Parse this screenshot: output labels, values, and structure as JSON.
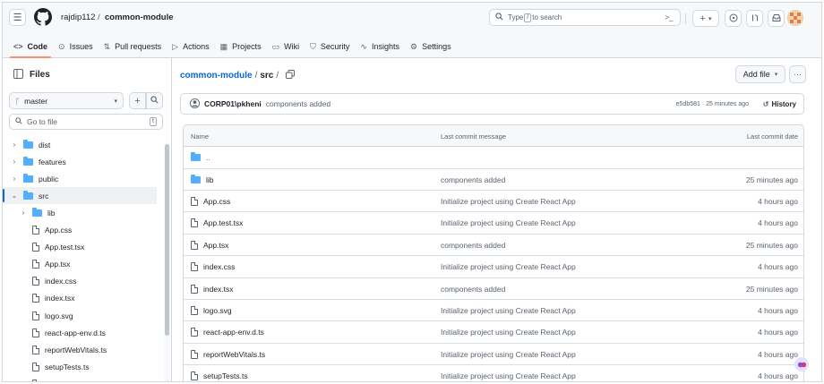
{
  "header": {
    "owner": "rajdip112",
    "separator": "/",
    "repo": "common-module",
    "search_placeholder": "Type",
    "search_key": "/",
    "search_suffix": "to search",
    "terminal_icon": ">_",
    "plus_label": "+",
    "plus_caret": "▾"
  },
  "tabs": [
    {
      "icon": "<>",
      "label": "Code"
    },
    {
      "icon": "⊙",
      "label": "Issues"
    },
    {
      "icon": "⇅",
      "label": "Pull requests"
    },
    {
      "icon": "▷",
      "label": "Actions"
    },
    {
      "icon": "▦",
      "label": "Projects"
    },
    {
      "icon": "▭",
      "label": "Wiki"
    },
    {
      "icon": "⛉",
      "label": "Security"
    },
    {
      "icon": "∿",
      "label": "Insights"
    },
    {
      "icon": "⚙",
      "label": "Settings"
    }
  ],
  "sidebar": {
    "title": "Files",
    "branch": "master",
    "goto_placeholder": "Go to file",
    "goto_key": "t",
    "tree": [
      {
        "type": "folder",
        "name": "dist",
        "chev": "›"
      },
      {
        "type": "folder",
        "name": "features",
        "chev": "›"
      },
      {
        "type": "folder",
        "name": "public",
        "chev": "›"
      },
      {
        "type": "folder",
        "name": "src",
        "chev": "⌄"
      },
      {
        "type": "folder",
        "name": "lib",
        "chev": "›"
      },
      {
        "type": "file",
        "name": "App.css"
      },
      {
        "type": "file",
        "name": "App.test.tsx"
      },
      {
        "type": "file",
        "name": "App.tsx"
      },
      {
        "type": "file",
        "name": "index.css"
      },
      {
        "type": "file",
        "name": "index.tsx"
      },
      {
        "type": "file",
        "name": "logo.svg"
      },
      {
        "type": "file",
        "name": "react-app-env.d.ts"
      },
      {
        "type": "file",
        "name": "reportWebVitals.ts"
      },
      {
        "type": "file",
        "name": "setupTests.ts"
      },
      {
        "type": "file",
        "name": "vite-env.d.ts"
      }
    ]
  },
  "main": {
    "path_repo": "common-module",
    "path_sep1": "/",
    "path_dir": "src",
    "path_sep2": "/",
    "add_file": "Add file",
    "more": "···",
    "commit": {
      "author": "CORP01\\pkheni",
      "message": "components added",
      "sha_time": "e5db581 · 25 minutes ago",
      "history": "History"
    },
    "columns": {
      "name": "Name",
      "message": "Last commit message",
      "date": "Last commit date"
    },
    "parent": "..",
    "files": [
      {
        "type": "folder",
        "name": "lib",
        "message": "components added",
        "date": "25 minutes ago"
      },
      {
        "type": "file",
        "name": "App.css",
        "message": "Initialize project using Create React App",
        "date": "4 hours ago"
      },
      {
        "type": "file",
        "name": "App.test.tsx",
        "message": "Initialize project using Create React App",
        "date": "4 hours ago"
      },
      {
        "type": "file",
        "name": "App.tsx",
        "message": "components added",
        "date": "25 minutes ago"
      },
      {
        "type": "file",
        "name": "index.css",
        "message": "Initialize project using Create React App",
        "date": "4 hours ago"
      },
      {
        "type": "file",
        "name": "index.tsx",
        "message": "components added",
        "date": "25 minutes ago"
      },
      {
        "type": "file",
        "name": "logo.svg",
        "message": "Initialize project using Create React App",
        "date": "4 hours ago"
      },
      {
        "type": "file",
        "name": "react-app-env.d.ts",
        "message": "Initialize project using Create React App",
        "date": "4 hours ago"
      },
      {
        "type": "file",
        "name": "reportWebVitals.ts",
        "message": "Initialize project using Create React App",
        "date": "4 hours ago"
      },
      {
        "type": "file",
        "name": "setupTests.ts",
        "message": "Initialize project using Create React App",
        "date": "4 hours ago"
      }
    ]
  },
  "colors": {
    "accent": "#fd8c73",
    "folder": "#54aeff",
    "link": "#0969da"
  }
}
